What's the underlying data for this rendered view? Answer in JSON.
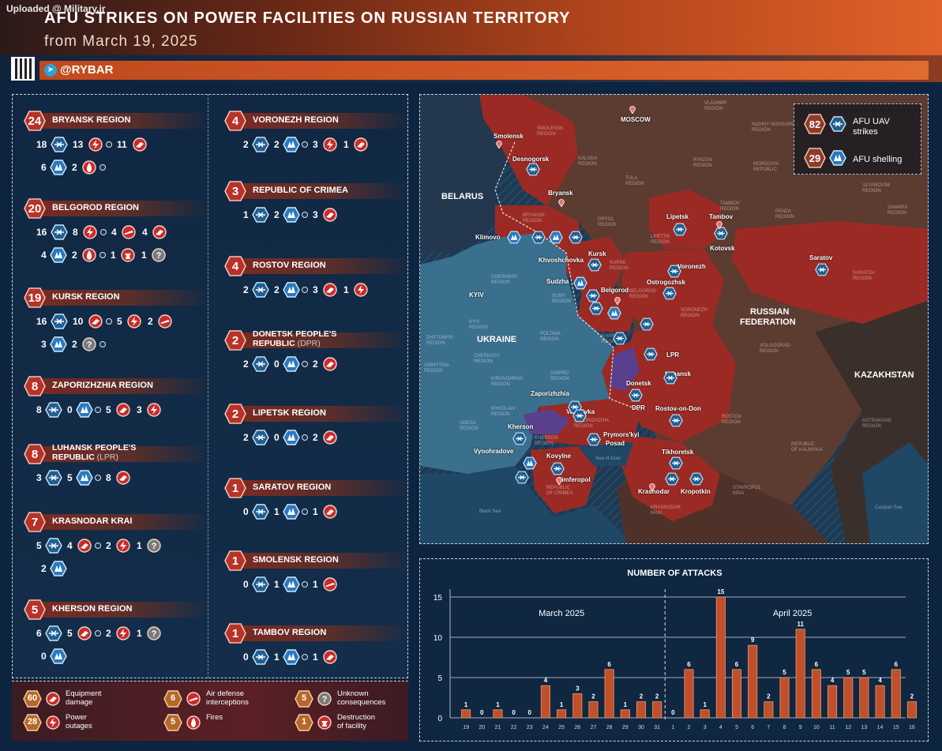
{
  "header": {
    "uploaded": "Uploaded @ Military.ir",
    "title": "AFU STRIKES ON POWER FACILITIES ON RUSSIAN TERRITORY",
    "subtitle": "from March 19, 2025",
    "brand": "@RYBAR"
  },
  "colors": {
    "uav": "#1e6ea8",
    "shell": "#2a7cc2",
    "equip": "#c52d2d",
    "accent": "#b4461c"
  },
  "regions_left": [
    {
      "total": "24",
      "name": "BRYANSK REGION",
      "rows": [
        [
          "18",
          "uav"
        ],
        [
          "13",
          "power"
        ],
        [
          "11",
          "equip"
        ]
      ],
      "rows2": [
        [
          "6",
          "shell"
        ],
        [
          "2",
          "fire"
        ]
      ]
    },
    {
      "total": "20",
      "name": "BELGOROD REGION",
      "rows": [
        [
          "16",
          "uav"
        ],
        [
          "8",
          "power"
        ],
        [
          "4",
          "defense"
        ],
        [
          "4",
          "equip"
        ]
      ],
      "rows2": [
        [
          "4",
          "shell"
        ],
        [
          "2",
          "fire"
        ],
        [
          "1",
          "destruct"
        ],
        [
          "1",
          "unknown"
        ]
      ]
    },
    {
      "total": "19",
      "name": "KURSK REGION",
      "rows": [
        [
          "16",
          "uav"
        ],
        [
          "10",
          "equip"
        ],
        [
          "5",
          "power"
        ],
        [
          "2",
          "defense"
        ]
      ],
      "rows2": [
        [
          "3",
          "shell"
        ],
        [
          "2",
          "unknown"
        ]
      ]
    },
    {
      "total": "8",
      "name": "ZAPORIZHZHIA REGION",
      "rows": [
        [
          "8",
          "uav"
        ],
        [
          "0",
          "shell"
        ],
        [
          "5",
          "equip"
        ],
        [
          "3",
          "power"
        ]
      ]
    },
    {
      "total": "8",
      "name": "LUHANSK PEOPLE'S",
      "name2": "REPUBLIC",
      "abbr": "(LPR)",
      "rows": [
        [
          "3",
          "uav"
        ],
        [
          "5",
          "shell"
        ],
        [
          "8",
          "equip"
        ]
      ]
    },
    {
      "total": "7",
      "name": "KRASNODAR KRAI",
      "rows": [
        [
          "5",
          "uav"
        ],
        [
          "4",
          "equip"
        ],
        [
          "2",
          "power"
        ],
        [
          "1",
          "unknown"
        ]
      ],
      "rows2": [
        [
          "2",
          "shell"
        ]
      ]
    },
    {
      "total": "5",
      "name": "KHERSON REGION",
      "rows": [
        [
          "6",
          "uav"
        ],
        [
          "5",
          "equip"
        ],
        [
          "2",
          "power"
        ],
        [
          "1",
          "unknown"
        ]
      ],
      "rows2": [
        [
          "0",
          "shell"
        ]
      ]
    }
  ],
  "regions_right": [
    {
      "total": "4",
      "name": "VORONEZH REGION",
      "rows": [
        [
          "2",
          "uav"
        ],
        [
          "2",
          "shell"
        ],
        [
          "3",
          "power"
        ],
        [
          "1",
          "equip"
        ]
      ]
    },
    {
      "total": "3",
      "name": "REPUBLIC OF CRIMEA",
      "rows": [
        [
          "1",
          "uav"
        ],
        [
          "2",
          "shell"
        ],
        [
          "3",
          "equip"
        ]
      ]
    },
    {
      "total": "4",
      "name": "ROSTOV REGION",
      "rows": [
        [
          "2",
          "uav"
        ],
        [
          "2",
          "shell"
        ],
        [
          "3",
          "equip"
        ],
        [
          "1",
          "power"
        ]
      ]
    },
    {
      "total": "2",
      "name": "DONETSK PEOPLE'S",
      "name2": "REPUBLIC",
      "abbr": "(DPR)",
      "rows": [
        [
          "2",
          "uav"
        ],
        [
          "0",
          "shell"
        ],
        [
          "2",
          "equip"
        ]
      ]
    },
    {
      "total": "2",
      "name": "LIPETSK REGION",
      "rows": [
        [
          "2",
          "uav"
        ],
        [
          "0",
          "shell"
        ],
        [
          "2",
          "equip"
        ]
      ]
    },
    {
      "total": "1",
      "name": "SARATOV REGION",
      "rows": [
        [
          "0",
          "uav"
        ],
        [
          "1",
          "shell"
        ],
        [
          "1",
          "equip"
        ]
      ]
    },
    {
      "total": "1",
      "name": "SMOLENSK REGION",
      "rows": [
        [
          "0",
          "uav"
        ],
        [
          "1",
          "shell"
        ],
        [
          "1",
          "defense"
        ]
      ]
    },
    {
      "total": "1",
      "name": "TAMBOV REGION",
      "rows": [
        [
          "0",
          "uav"
        ],
        [
          "1",
          "shell"
        ],
        [
          "1",
          "equip"
        ]
      ]
    }
  ],
  "legend": [
    {
      "value": "60",
      "kind": "equip",
      "l1": "Equipment",
      "l2": "damage"
    },
    {
      "value": "6",
      "kind": "defense",
      "l1": "Air defense",
      "l2": "interceptions"
    },
    {
      "value": "5",
      "kind": "unknown",
      "l1": "Unknown",
      "l2": "consequences"
    },
    {
      "value": "28",
      "kind": "power",
      "l1": "Power",
      "l2": "outages"
    },
    {
      "value": "5",
      "kind": "fire",
      "l1": "Fires",
      "l2": ""
    },
    {
      "value": "1",
      "kind": "destruct",
      "l1": "Destruction",
      "l2": "of facility"
    }
  ],
  "map": {
    "legend": [
      {
        "value": "82",
        "l1": "AFU UAV",
        "l2": "strikes"
      },
      {
        "value": "29",
        "l1": "AFU shelling",
        "l2": ""
      }
    ],
    "countries": {
      "belarus": "BELARUS",
      "ukraine": "UKRAINE",
      "russia1": "RUSSIAN",
      "russia2": "FEDERATION",
      "kazakhstan": "KAZAKHSTAN"
    },
    "seas": {
      "black": "Black Sea",
      "azov": "Sea of Azov",
      "caspian": "Caspian Sea"
    },
    "cities": [
      "MOSCOW",
      "Smolensk",
      "Desnogorsk",
      "Bryansk",
      "Klimovo",
      "Khvoshchovka",
      "Kursk",
      "Sudzha",
      "Belgorod",
      "Lipetsk",
      "Tambov",
      "Kotovsk",
      "Voronezh",
      "Ostrogozhsk",
      "Saratov",
      "KYIV",
      "LPR",
      "Luhansk",
      "Donetsk",
      "DPR",
      "Zaporizhzhia",
      "Vasylivka",
      "Rostov-on-Don",
      "Kherson",
      "Prymors'kyi",
      "Posad",
      "Vynohradove",
      "Kovylne",
      "Simferopol",
      "Tikhoretsk",
      "Krasnodar",
      "Kropotkin"
    ],
    "region_labels": [
      "SMOLENSK",
      "REGION",
      "KALUGA",
      "REGION",
      "TULA",
      "REGION",
      "RYAZAN",
      "REGION",
      "VLADIMIR",
      "REGION",
      "NIZHNY NOVGOROD",
      "REGION",
      "MORDOVIA",
      "REPUBLIC",
      "ULYANOVSK",
      "REGION",
      "PENZA",
      "REGION",
      "SAMARA",
      "REGION",
      "TAMBOV",
      "REGION",
      "LIPETSK",
      "REGION",
      "ORYOL",
      "REGION",
      "BRYANSK",
      "REGION",
      "KURSK",
      "REGION",
      "BELGOROD",
      "REGION",
      "VORONEZH",
      "REGION",
      "SARATOV",
      "REGION",
      "VOLGOGRAD",
      "REGION",
      "ROSTOV",
      "REGION",
      "ASTRAKHAN",
      "REGION",
      "REPUBLIC",
      "OF KALMYKIA",
      "STAVROPOL",
      "KRAI",
      "KRASNODAR",
      "KRAI",
      "CHERNIHIV",
      "REGION",
      "SUMY",
      "REGION",
      "KYIV",
      "REGION",
      "ZHYTOMYR",
      "REGION",
      "POLTAVA",
      "REGION",
      "KHARKIV",
      "REGION",
      "CHERKASY",
      "REGION",
      "VINNYTSIA",
      "REGION",
      "KIROVOHRAD",
      "REGION",
      "DNIPRO",
      "REGION",
      "MYKOLAIV",
      "REGION",
      "ODESA",
      "REGION",
      "KHERSON",
      "REGION",
      "ZAPORIZHZHIA",
      "REGION",
      "REPUBLIC",
      "OF CRIMEA"
    ]
  },
  "chart_data": {
    "type": "bar",
    "title": "NUMBER OF ATTACKS",
    "period_labels": [
      "March 2025",
      "April 2025"
    ],
    "categories": [
      "19",
      "20",
      "21",
      "22",
      "23",
      "24",
      "25",
      "26",
      "27",
      "28",
      "29",
      "30",
      "31",
      "1",
      "2",
      "3",
      "4",
      "5",
      "6",
      "7",
      "8",
      "9",
      "10",
      "11",
      "12",
      "13",
      "14",
      "15",
      "16"
    ],
    "values": [
      1,
      0,
      1,
      0,
      0,
      4,
      1,
      3,
      2,
      6,
      1,
      2,
      2,
      0,
      6,
      1,
      15,
      6,
      9,
      2,
      5,
      11,
      6,
      4,
      5,
      5,
      4,
      6,
      2
    ],
    "ylim": [
      0,
      15
    ],
    "yticks": [
      "0",
      "5",
      "10",
      "15"
    ],
    "grid": true
  }
}
